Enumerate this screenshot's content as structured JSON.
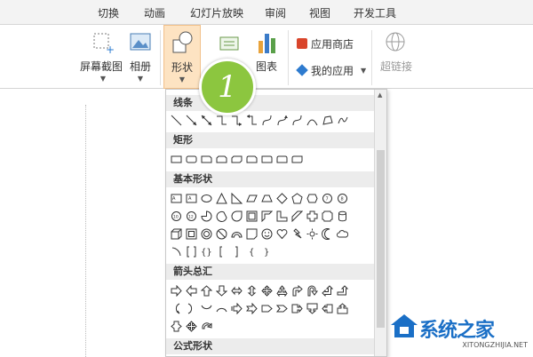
{
  "tabs": [
    "切换",
    "动画",
    "幻灯片放映",
    "审阅",
    "视图",
    "开发工具"
  ],
  "ribbon": {
    "screenshot_label": "屏幕截图",
    "album_label": "相册",
    "shapes_label": "形状",
    "chart_label": "图表",
    "app_store_label": "应用商店",
    "my_apps_label": "我的应用",
    "hyperlink_label": "超链接"
  },
  "badge_number": "1",
  "gallery": {
    "sections": [
      {
        "title": "线条"
      },
      {
        "title": "矩形"
      },
      {
        "title": "基本形状"
      },
      {
        "title": "箭头总汇"
      },
      {
        "title": "公式形状"
      }
    ]
  },
  "watermark": {
    "brand": "系统之家",
    "url": "XITONGZHIJIA.NET"
  },
  "colors": {
    "badge": "#8cc63f",
    "shapes_highlight": "#fde3c2",
    "brand_blue": "#1a6fc6"
  }
}
